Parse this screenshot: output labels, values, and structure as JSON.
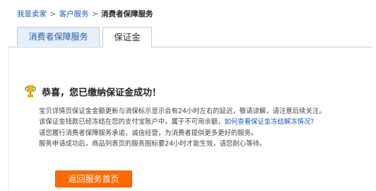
{
  "breadcrumb": {
    "items": [
      "我是卖家",
      "客户服务"
    ],
    "separator": ">",
    "current": "消费者保障服务"
  },
  "tabs": [
    {
      "label": "消费者保障服务"
    },
    {
      "label": "保证金"
    }
  ],
  "success": {
    "icon": "trophy-icon",
    "title": "恭喜，您已缴纳保证金成功！"
  },
  "info": {
    "line1": "宝贝详情页保证金金额更新与消保标示显示会有24小时左右的延迟，敬请谅解，请注意后续关注。",
    "line2_text": "该保证金钱款已经冻结在您的支付宝账户中，属于不可用余额，",
    "line2_link": "如何查看保证金冻结解冻情况?",
    "line3": "请您履行消费者保障服务承诺，诚信经营，为消费者提供更多更好的服务。",
    "line4": "服务申请成功后，商品列表页的服务图标要24小时才能生效，请您耐心等待。"
  },
  "actions": {
    "return_label": "返回服务首页"
  },
  "colors": {
    "link": "#1a5eb0",
    "button": "#ff6a00",
    "tab_border": "#b8cde3"
  }
}
